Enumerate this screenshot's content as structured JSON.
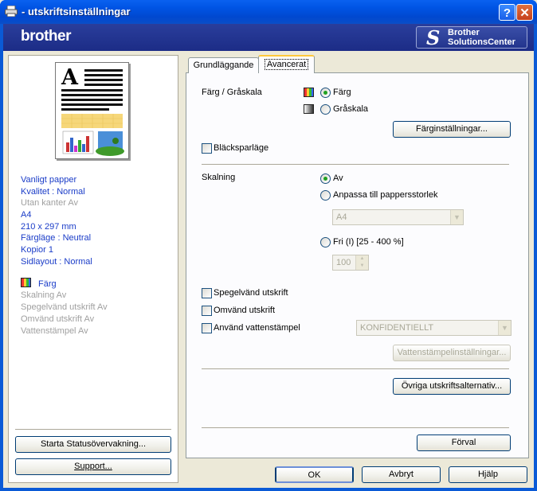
{
  "window": {
    "title": "- utskriftsinställningar",
    "help_glyph": "?",
    "close_glyph": "✕"
  },
  "banner": {
    "logo": "brother",
    "solutions_line1": "Brother",
    "solutions_line2": "SolutionsCenter"
  },
  "summary": {
    "preview_letter": "A",
    "items": [
      {
        "text": "Vanligt papper",
        "state": "active"
      },
      {
        "text": "Kvalitet : Normal",
        "state": "active"
      },
      {
        "text": "Utan kanter Av",
        "state": "inactive"
      },
      {
        "text": "A4",
        "state": "active"
      },
      {
        "text": "210 x 297 mm",
        "state": "active"
      },
      {
        "text": "Färgläge : Neutral",
        "state": "active"
      },
      {
        "text": "Kopior 1",
        "state": "active"
      },
      {
        "text": "Sidlayout : Normal",
        "state": "active"
      }
    ],
    "color_label": "Färg",
    "items2": [
      {
        "text": "Skalning Av",
        "state": "inactive"
      },
      {
        "text": "Spegelvänd utskrift Av",
        "state": "inactive"
      },
      {
        "text": "Omvänd utskrift Av",
        "state": "inactive"
      },
      {
        "text": "Vattenstämpel Av",
        "state": "inactive"
      }
    ],
    "status_button": "Starta Statusövervakning...",
    "support_button": "Support..."
  },
  "tabs": [
    {
      "label": "Grundläggande",
      "active": false
    },
    {
      "label": "Avancerat",
      "active": true
    }
  ],
  "advanced": {
    "color_section_label": "Färg / Gråskala",
    "color_option": "Färg",
    "gray_option": "Gråskala",
    "color_mode_selected": "Färg",
    "color_settings_button": "Färginställningar...",
    "ink_save_label": "Bläcksparläge",
    "ink_save_checked": false,
    "scaling_label": "Skalning",
    "scaling_off": "Av",
    "scaling_fit": "Anpassa till pappersstorlek",
    "scaling_selected": "Av",
    "paper_size_value": "A4",
    "scaling_free": "Fri (I) [25 - 400 %]",
    "scaling_percent": "100",
    "mirror_label": "Spegelvänd utskrift",
    "mirror_checked": false,
    "reverse_label": "Omvänd utskrift",
    "reverse_checked": false,
    "watermark_label": "Använd vattenstämpel",
    "watermark_checked": false,
    "watermark_value": "KONFIDENTIELLT",
    "watermark_settings_button": "Vattenstämpelinställningar...",
    "other_options_button": "Övriga utskriftsalternativ...",
    "default_button": "Förval"
  },
  "footer": {
    "ok": "OK",
    "cancel": "Avbryt",
    "help": "Hjälp"
  },
  "colors": {
    "titlebar": "#0055e5",
    "banner": "#23358e",
    "radio_dot": "#21a121",
    "summary_active": "#1a3cc8",
    "summary_inactive": "#a0a0a0"
  }
}
